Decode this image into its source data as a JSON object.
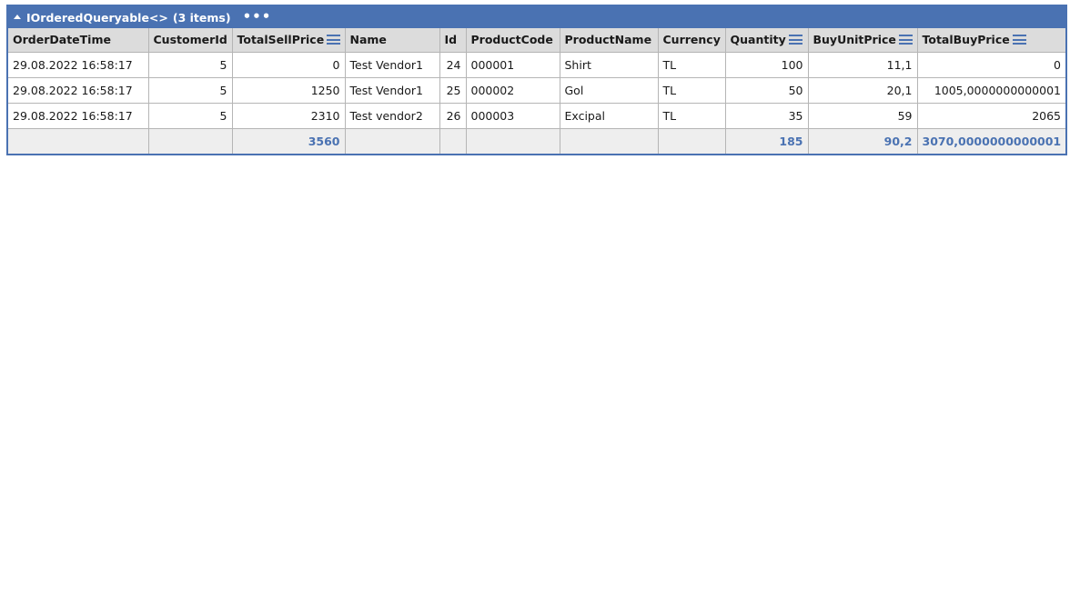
{
  "panel": {
    "title": "IOrderedQueryable<>",
    "count": "(3 items)",
    "more": "•••"
  },
  "colors": {
    "accent": "#4a72b2",
    "header_bg": "#dcdcdc",
    "totals_bg": "#eeeeee"
  },
  "icons": {
    "collapse": "triangle-up-icon",
    "more": "ellipsis-icon",
    "sum": "sum-menu-icon"
  },
  "columns": [
    {
      "label": "OrderDateTime"
    },
    {
      "label": "CustomerId"
    },
    {
      "label": "TotalSellPrice"
    },
    {
      "label": "Name"
    },
    {
      "label": "Id"
    },
    {
      "label": "ProductCode"
    },
    {
      "label": "ProductName"
    },
    {
      "label": "Currency"
    },
    {
      "label": "Quantity"
    },
    {
      "label": "BuyUnitPrice"
    },
    {
      "label": "TotalBuyPrice"
    }
  ],
  "rows": [
    [
      "29.08.2022 16:58:17",
      "5",
      "0",
      "Test Vendor1",
      "24",
      "000001",
      "Shirt",
      "TL",
      "100",
      "11,1",
      "0"
    ],
    [
      "29.08.2022 16:58:17",
      "5",
      "1250",
      "Test Vendor1",
      "25",
      "000002",
      "Gol",
      "TL",
      "50",
      "20,1",
      "1005,0000000000001"
    ],
    [
      "29.08.2022 16:58:17",
      "5",
      "2310",
      "Test vendor2",
      "26",
      "000003",
      "Excipal",
      "TL",
      "35",
      "59",
      "2065"
    ]
  ],
  "totals": [
    "",
    "",
    "3560",
    "",
    "",
    "",
    "",
    "",
    "185",
    "90,2",
    "3070,0000000000001"
  ]
}
